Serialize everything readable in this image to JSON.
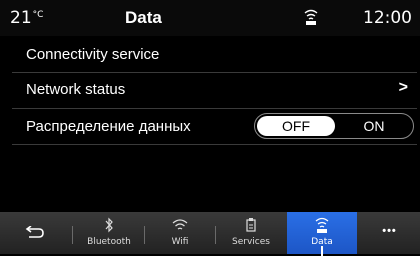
{
  "status": {
    "temperature": "21",
    "temperature_unit": "°C",
    "title": "Data",
    "time": "12:00",
    "connection_icon": "wifi-icon"
  },
  "rows": [
    {
      "label": "Connectivity service"
    },
    {
      "label": "Network status",
      "chevron": ">"
    },
    {
      "label": "Распределение данных"
    }
  ],
  "toggle": {
    "off_label": "OFF",
    "on_label": "ON",
    "selected": "OFF"
  },
  "nav": {
    "back_icon": "back-arrow-icon",
    "items": [
      {
        "label": "Bluetooth",
        "icon": "bluetooth-icon"
      },
      {
        "label": "Wifi",
        "icon": "wifi-icon"
      },
      {
        "label": "Services",
        "icon": "services-icon"
      },
      {
        "label": "Data",
        "icon": "data-icon",
        "active": true
      }
    ],
    "more_label": "•••"
  },
  "colors": {
    "active_tab": "#2a6fe6",
    "background": "#000000",
    "text": "#ffffff"
  }
}
